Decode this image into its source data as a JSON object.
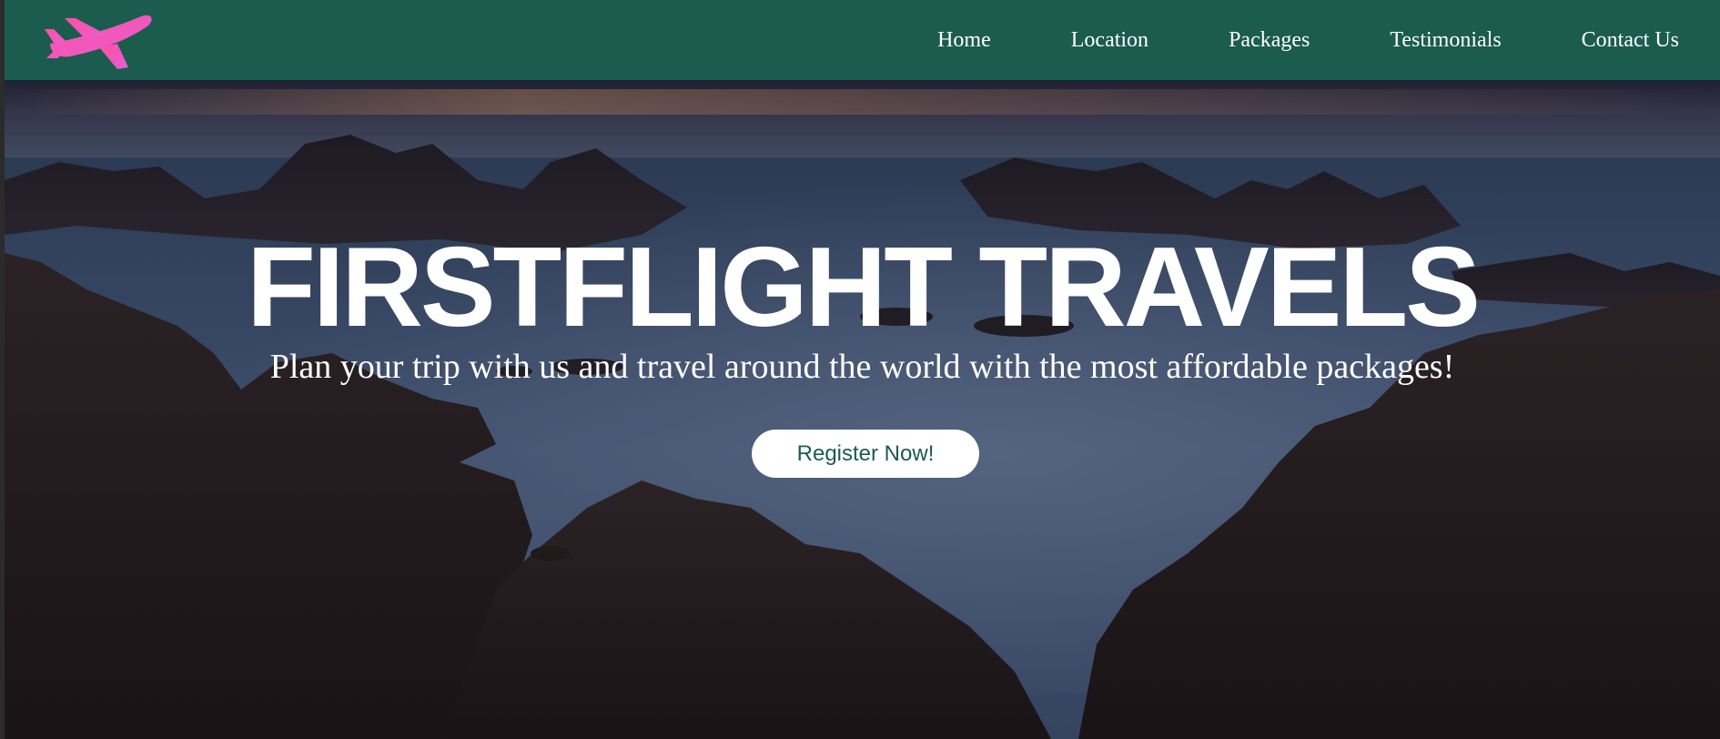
{
  "brand": {
    "logo_icon": "airplane-icon",
    "logo_gradient": [
      "#ff4fa3",
      "#e85fd0"
    ]
  },
  "nav": {
    "items": [
      {
        "label": "Home"
      },
      {
        "label": "Location"
      },
      {
        "label": "Packages"
      },
      {
        "label": "Testimonials"
      },
      {
        "label": "Contact Us"
      }
    ]
  },
  "hero": {
    "title": "FIRSTFLIGHT TRAVELS",
    "subtitle": "Plan your trip with us and travel around the world with the most affordable packages!",
    "cta_label": "Register Now!",
    "background": "rocky-seashore-photo"
  },
  "colors": {
    "navbar": "#1b5c4f",
    "cta_text": "#1b5c4f",
    "cta_bg": "#ffffff",
    "text": "#ffffff"
  }
}
